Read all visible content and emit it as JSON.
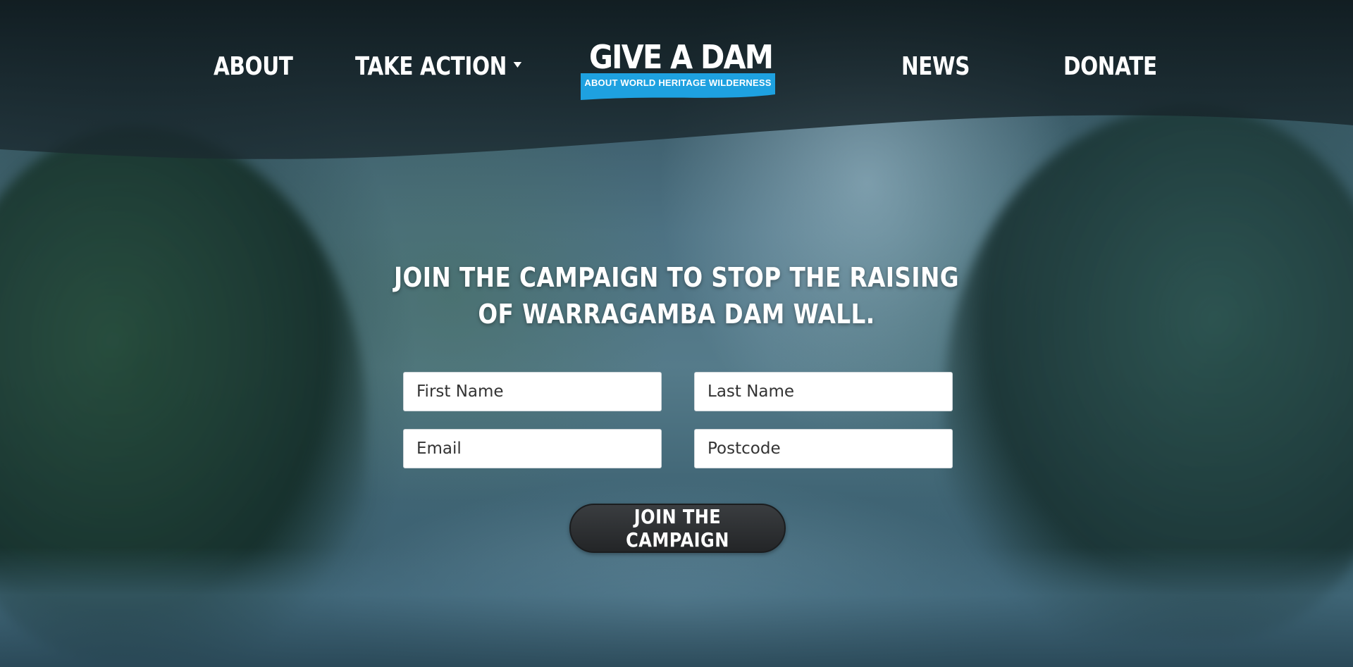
{
  "nav": {
    "about": "ABOUT",
    "take_action": "TAKE ACTION",
    "news": "NEWS",
    "donate": "DONATE"
  },
  "logo": {
    "title": "GIVE A DAM",
    "subtitle": "ABOUT WORLD HERITAGE WILDERNESS"
  },
  "hero": {
    "line1": "JOIN THE CAMPAIGN TO STOP THE RAISING",
    "line2": "OF WARRAGAMBA DAM WALL."
  },
  "form": {
    "first_name_placeholder": "First Name",
    "last_name_placeholder": "Last Name",
    "email_placeholder": "Email",
    "postcode_placeholder": "Postcode",
    "submit_label": "JOIN THE CAMPAIGN"
  },
  "colors": {
    "logo_ribbon": "#1ea1e0",
    "button_bg": "#2b2d30",
    "header_overlay": "#0f1a1e"
  },
  "icons": {
    "take_action_dropdown": "caret-down-icon"
  }
}
